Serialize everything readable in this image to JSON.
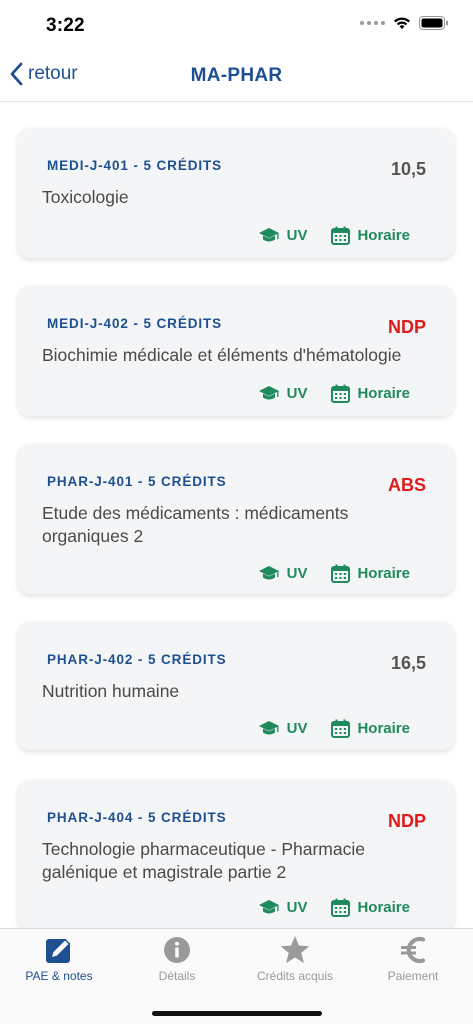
{
  "status_bar": {
    "time": "3:22"
  },
  "nav": {
    "back_label": "retour",
    "title": "MA-PHAR"
  },
  "courses": [
    {
      "code": "MEDI-J-401 - 5 CRÉDITS",
      "name": "Toxicologie",
      "grade": "10,5",
      "grade_color": "#555555"
    },
    {
      "code": "MEDI-J-402 - 5 CRÉDITS",
      "name": "Biochimie médicale et éléments d'hématologie",
      "grade": "NDP",
      "grade_color": "#e01b1b"
    },
    {
      "code": "PHAR-J-401 - 5 CRÉDITS",
      "name": "Etude des médicaments : médicaments organiques 2",
      "grade": "ABS",
      "grade_color": "#e01b1b"
    },
    {
      "code": "PHAR-J-402 - 5 CRÉDITS",
      "name": "Nutrition humaine",
      "grade": "16,5",
      "grade_color": "#555555"
    },
    {
      "code": "PHAR-J-404 - 5 CRÉDITS",
      "name": "Technologie pharmaceutique - Pharmacie galénique et magistrale partie 2",
      "grade": "NDP",
      "grade_color": "#e01b1b"
    }
  ],
  "actions": {
    "uv_label": "UV",
    "horaire_label": "Horaire"
  },
  "tabs": [
    {
      "label": "PAE & notes",
      "icon": "edit-icon"
    },
    {
      "label": "Détails",
      "icon": "info-icon"
    },
    {
      "label": "Crédits acquis",
      "icon": "star-icon"
    },
    {
      "label": "Paiement",
      "icon": "euro-icon"
    }
  ],
  "colors": {
    "primary": "#1d4f91",
    "accent_green": "#1f8a5b",
    "alert_red": "#e01b1b"
  }
}
